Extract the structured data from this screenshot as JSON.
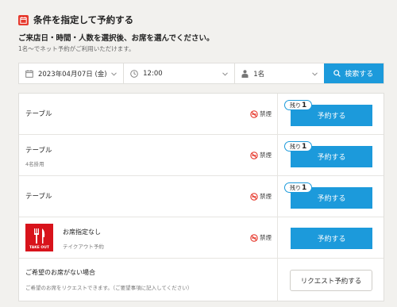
{
  "header": {
    "title": "条件を指定して予約する",
    "instruction": "ご来店日・時間・人数を選択後、お席を選んでください。",
    "note": "1名〜でネット予約がご利用いただけます。"
  },
  "search": {
    "date": "2023年04月07日 (金)",
    "time": "12:00",
    "people": "1名",
    "button_label": "検索する"
  },
  "seats": [
    {
      "name": "テーブル",
      "note": "",
      "smoking": "禁煙",
      "remaining_label": "残り",
      "remaining_count": "1",
      "button_label": "予約する"
    },
    {
      "name": "テーブル",
      "note": "4名掛用",
      "smoking": "禁煙",
      "remaining_label": "残り",
      "remaining_count": "1",
      "button_label": "予約する"
    },
    {
      "name": "テーブル",
      "note": "",
      "smoking": "禁煙",
      "remaining_label": "残り",
      "remaining_count": "1",
      "button_label": "予約する"
    },
    {
      "name": "お席指定なし",
      "note": "テイクアウト予約",
      "smoking": "禁煙",
      "thumbnail_text": "TAKE OUT",
      "button_label": "予約する"
    }
  ],
  "request": {
    "title": "ご希望のお席がない場合",
    "description": "ご希望のお席をリクエストできます。（ご要望事項に記入してください）",
    "button_label": "リクエスト予約する"
  },
  "colors": {
    "accent": "#1c9adb",
    "brand_red": "#e63a2e",
    "takeout_red": "#d8131b"
  }
}
